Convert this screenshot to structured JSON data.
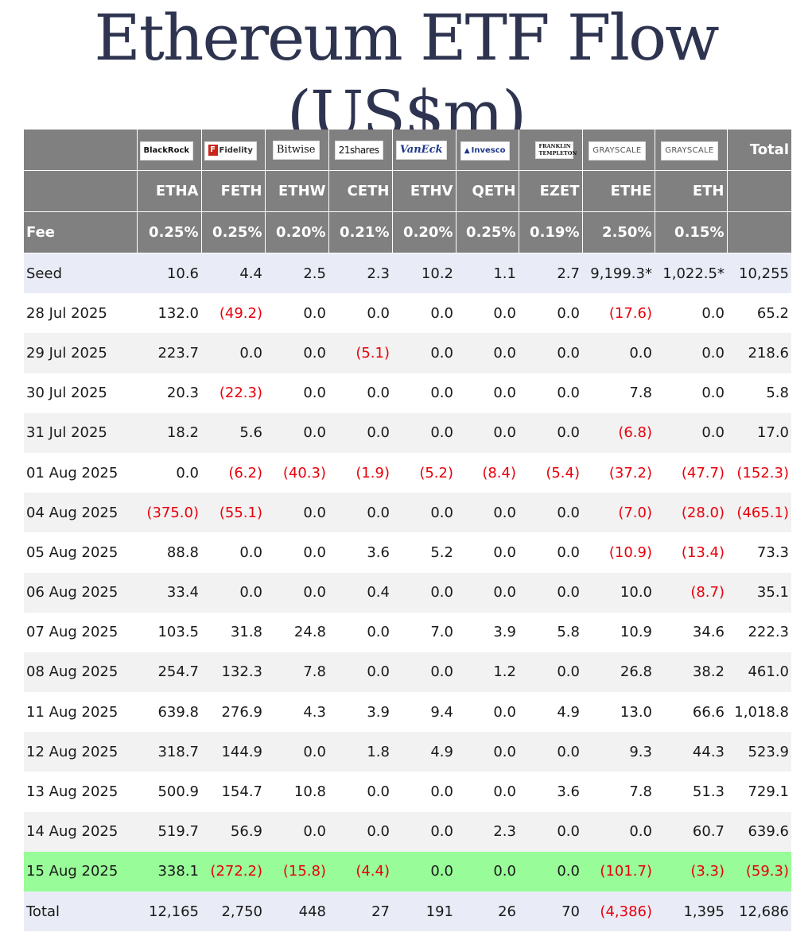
{
  "title": "Ethereum ETF Flow (US$m)",
  "header": {
    "total_label": "Total",
    "fee_label": "Fee",
    "issuers": [
      "BlackRock",
      "Fidelity",
      "Bitwise",
      "21shares",
      "VanEck",
      "Invesco",
      "FRANKLIN TEMPLETON",
      "GRAYSCALE",
      "GRAYSCALE"
    ],
    "tickers": [
      "ETHA",
      "FETH",
      "ETHW",
      "CETH",
      "ETHV",
      "QETH",
      "EZET",
      "ETHE",
      "ETH"
    ],
    "fees": [
      "0.25%",
      "0.25%",
      "0.20%",
      "0.21%",
      "0.20%",
      "0.25%",
      "0.19%",
      "2.50%",
      "0.15%"
    ]
  },
  "colors": {
    "header_bg": "#808080",
    "seed_bg": "#e9ecf6",
    "stripe_bg": "#f2f2f2",
    "highlight_bg": "#98fc98",
    "negative": "#e8000b",
    "title": "#2e3450"
  },
  "rows": [
    {
      "date": "Seed",
      "values": [
        "10.6",
        "4.4",
        "2.5",
        "2.3",
        "10.2",
        "1.1",
        "2.7",
        "9,199.3*",
        "1,022.5*",
        "10,255"
      ],
      "style": "seed"
    },
    {
      "date": "28 Jul 2025",
      "values": [
        "132.0",
        "(49.2)",
        "0.0",
        "0.0",
        "0.0",
        "0.0",
        "0.0",
        "(17.6)",
        "0.0",
        "65.2"
      ],
      "style": "odd"
    },
    {
      "date": "29 Jul 2025",
      "values": [
        "223.7",
        "0.0",
        "0.0",
        "(5.1)",
        "0.0",
        "0.0",
        "0.0",
        "0.0",
        "0.0",
        "218.6"
      ],
      "style": "even"
    },
    {
      "date": "30 Jul 2025",
      "values": [
        "20.3",
        "(22.3)",
        "0.0",
        "0.0",
        "0.0",
        "0.0",
        "0.0",
        "7.8",
        "0.0",
        "5.8"
      ],
      "style": "odd"
    },
    {
      "date": "31 Jul 2025",
      "values": [
        "18.2",
        "5.6",
        "0.0",
        "0.0",
        "0.0",
        "0.0",
        "0.0",
        "(6.8)",
        "0.0",
        "17.0"
      ],
      "style": "even"
    },
    {
      "date": "01 Aug 2025",
      "values": [
        "0.0",
        "(6.2)",
        "(40.3)",
        "(1.9)",
        "(5.2)",
        "(8.4)",
        "(5.4)",
        "(37.2)",
        "(47.7)",
        "(152.3)"
      ],
      "style": "odd"
    },
    {
      "date": "04 Aug 2025",
      "values": [
        "(375.0)",
        "(55.1)",
        "0.0",
        "0.0",
        "0.0",
        "0.0",
        "0.0",
        "(7.0)",
        "(28.0)",
        "(465.1)"
      ],
      "style": "even"
    },
    {
      "date": "05 Aug 2025",
      "values": [
        "88.8",
        "0.0",
        "0.0",
        "3.6",
        "5.2",
        "0.0",
        "0.0",
        "(10.9)",
        "(13.4)",
        "73.3"
      ],
      "style": "odd"
    },
    {
      "date": "06 Aug 2025",
      "values": [
        "33.4",
        "0.0",
        "0.0",
        "0.4",
        "0.0",
        "0.0",
        "0.0",
        "10.0",
        "(8.7)",
        "35.1"
      ],
      "style": "even"
    },
    {
      "date": "07 Aug 2025",
      "values": [
        "103.5",
        "31.8",
        "24.8",
        "0.0",
        "7.0",
        "3.9",
        "5.8",
        "10.9",
        "34.6",
        "222.3"
      ],
      "style": "odd"
    },
    {
      "date": "08 Aug 2025",
      "values": [
        "254.7",
        "132.3",
        "7.8",
        "0.0",
        "0.0",
        "1.2",
        "0.0",
        "26.8",
        "38.2",
        "461.0"
      ],
      "style": "even"
    },
    {
      "date": "11 Aug 2025",
      "values": [
        "639.8",
        "276.9",
        "4.3",
        "3.9",
        "9.4",
        "0.0",
        "4.9",
        "13.0",
        "66.6",
        "1,018.8"
      ],
      "style": "odd"
    },
    {
      "date": "12 Aug 2025",
      "values": [
        "318.7",
        "144.9",
        "0.0",
        "1.8",
        "4.9",
        "0.0",
        "0.0",
        "9.3",
        "44.3",
        "523.9"
      ],
      "style": "even"
    },
    {
      "date": "13 Aug 2025",
      "values": [
        "500.9",
        "154.7",
        "10.8",
        "0.0",
        "0.0",
        "0.0",
        "3.6",
        "7.8",
        "51.3",
        "729.1"
      ],
      "style": "odd"
    },
    {
      "date": "14 Aug 2025",
      "values": [
        "519.7",
        "56.9",
        "0.0",
        "0.0",
        "0.0",
        "2.3",
        "0.0",
        "0.0",
        "60.7",
        "639.6"
      ],
      "style": "even"
    },
    {
      "date": "15 Aug 2025",
      "values": [
        "338.1",
        "(272.2)",
        "(15.8)",
        "(4.4)",
        "0.0",
        "0.0",
        "0.0",
        "(101.7)",
        "(3.3)",
        "(59.3)"
      ],
      "style": "highlight"
    },
    {
      "date": "Total",
      "values": [
        "12,165",
        "2,750",
        "448",
        "27",
        "191",
        "26",
        "70",
        "(4,386)",
        "1,395",
        "12,686"
      ],
      "style": "totalrow"
    }
  ]
}
